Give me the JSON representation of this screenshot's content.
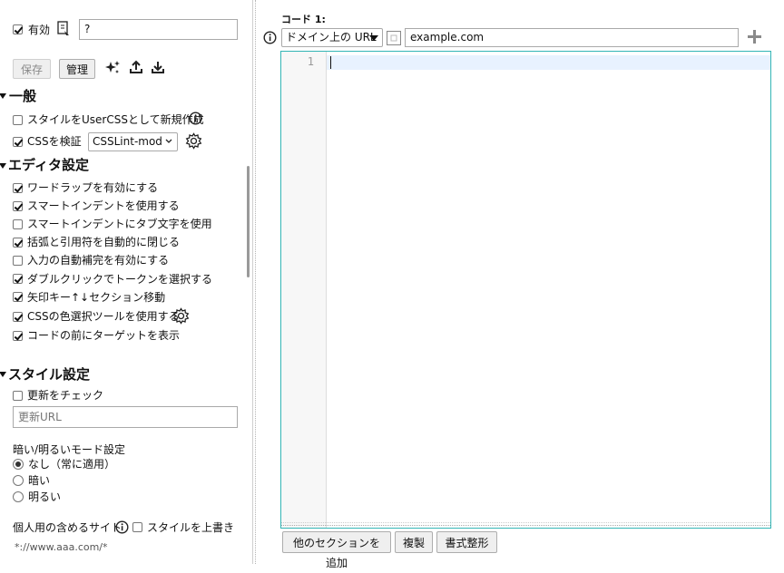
{
  "top": {
    "enabled_label": "有効",
    "enabled_checked": true,
    "name_value": "?",
    "save_label": "保存",
    "manage_label": "管理"
  },
  "general": {
    "heading": "一般",
    "new_usercss_label": "スタイルをUserCSSとして新規作成",
    "new_usercss_checked": false,
    "validate_label": "CSSを検証",
    "validate_checked": true,
    "linter_value": "CSSLint-mod"
  },
  "editor_settings": {
    "heading": "エディタ設定",
    "items": [
      {
        "label": "ワードラップを有効にする",
        "checked": true
      },
      {
        "label": "スマートインデントを使用する",
        "checked": true
      },
      {
        "label": "スマートインデントにタブ文字を使用",
        "checked": false
      },
      {
        "label": "括弧と引用符を自動的に閉じる",
        "checked": true
      },
      {
        "label": "入力の自動補完を有効にする",
        "checked": false
      },
      {
        "label": "ダブルクリックでトークンを選択する",
        "checked": true
      },
      {
        "label": "矢印キー↑↓セクション移動",
        "checked": true
      },
      {
        "label": "CSSの色選択ツールを使用する",
        "checked": true
      },
      {
        "label": "コードの前にターゲットを表示",
        "checked": true
      }
    ]
  },
  "style_settings": {
    "heading": "スタイル設定",
    "check_updates_label": "更新をチェック",
    "check_updates_checked": false,
    "update_url_placeholder": "更新URL",
    "dark_mode_title": "暗い/明るいモード設定",
    "dark_mode_options": [
      {
        "label": "なし（常に適用）",
        "selected": true
      },
      {
        "label": "暗い",
        "selected": false
      },
      {
        "label": "明るい",
        "selected": false
      }
    ],
    "personal_sites_label": "個人用の含めるサイト",
    "override_label": "スタイルを上書き",
    "override_checked": false,
    "personal_sites_value": "*://www.aaa.com/*"
  },
  "section": {
    "code_label": "コード 1:",
    "target_type": "ドメイン上の URL",
    "target_value": "example.com",
    "line_number": "1"
  },
  "bottom": {
    "add_section_label": "他のセクションを追加",
    "clone_label": "複製",
    "beautify_label": "書式整形"
  },
  "icons": {
    "info": "info-icon",
    "sparkle": "sparkle-icon",
    "export": "export-icon",
    "import": "import-icon",
    "gear": "gear-icon",
    "plus": "plus-icon",
    "style_info": "style-info-icon"
  },
  "colors": {
    "editor_border": "#33b5b5",
    "active_line": "#e8f2ff"
  }
}
